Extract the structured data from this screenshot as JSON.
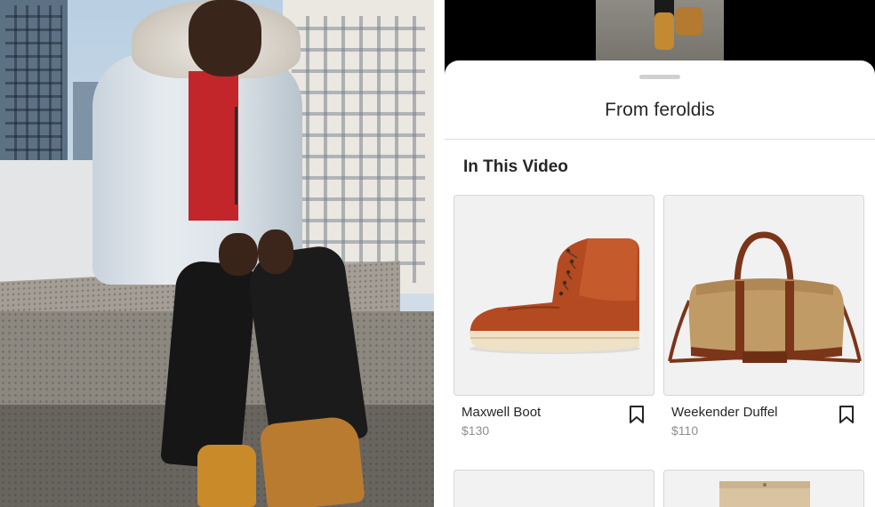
{
  "sheet": {
    "title": "From feroldis",
    "section_title": "In This Video"
  },
  "products": [
    {
      "name": "Maxwell Boot",
      "price": "$130",
      "icon": "bookmark-icon"
    },
    {
      "name": "Weekender Duffel",
      "price": "$110",
      "icon": "bookmark-icon"
    }
  ],
  "colors": {
    "sheet_background": "#ffffff",
    "text_primary": "#262626",
    "text_secondary": "#8e8e8e",
    "divider": "#dbdbdb"
  }
}
